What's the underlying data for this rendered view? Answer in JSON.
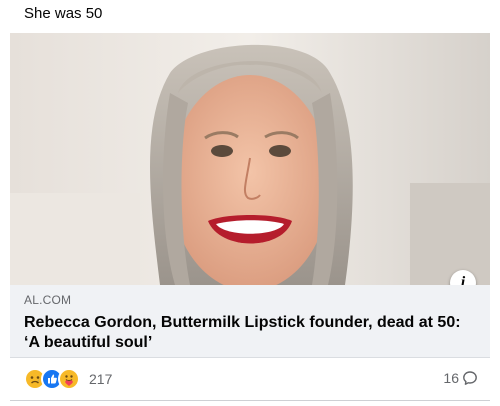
{
  "post": {
    "text": "She was 50"
  },
  "link_preview": {
    "domain": "AL.COM",
    "headline": "Rebecca Gordon, Buttermilk Lipstick founder, dead at 50: ‘A beautiful soul’",
    "info_icon": "i"
  },
  "engagement": {
    "reactions": [
      "sad-reaction-icon",
      "like-reaction-icon",
      "care-reaction-icon"
    ],
    "reaction_count": "217",
    "comment_count": "16",
    "comment_icon": "comment-bubble-icon"
  },
  "colors": {
    "secondary_text": "#65676b",
    "link_box_bg": "#f0f2f5",
    "like_blue": "#1877f2",
    "reaction_yellow": "#f7b928"
  }
}
